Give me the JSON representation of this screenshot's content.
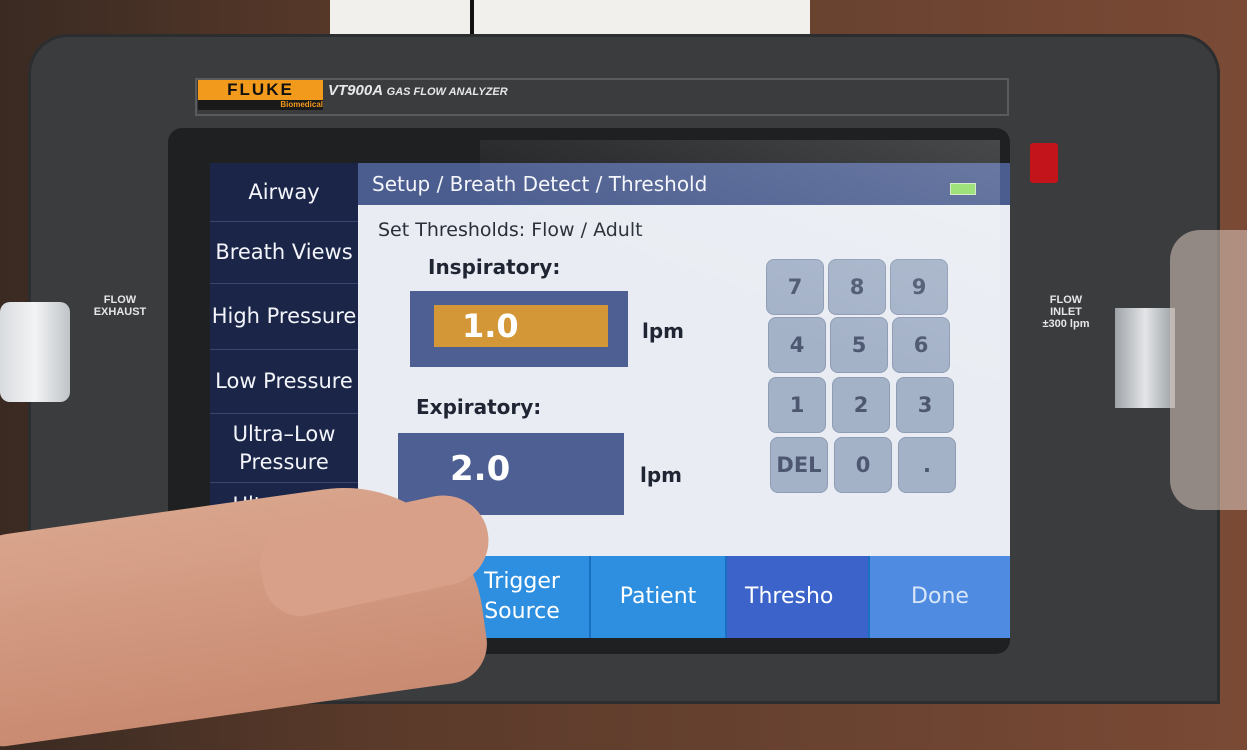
{
  "device": {
    "brand": "FLUKE",
    "brand_sub": "Biomedical",
    "model": "VT900A",
    "model_desc": "GAS FLOW ANALYZER",
    "left_port": "FLOW EXHAUST",
    "right_port_line1": "FLOW",
    "right_port_line2": "INLET",
    "right_port_line3": "±300 lpm"
  },
  "screen": {
    "breadcrumb": "Setup / Breath Detect / Threshold",
    "subtitle": "Set Thresholds:  Flow / Adult",
    "sidebar": {
      "items": [
        {
          "label": "Airway"
        },
        {
          "label": "Breath Views"
        },
        {
          "label": "High Pressure"
        },
        {
          "label": "Low Pressure"
        },
        {
          "label": "Ultra–Low Pressure"
        },
        {
          "label": "Ultra–Low"
        }
      ]
    },
    "inspiratory": {
      "label": "Inspiratory:",
      "value": "1.0",
      "unit": "lpm"
    },
    "expiratory": {
      "label": "Expiratory:",
      "value": "2.0",
      "unit": "lpm"
    },
    "keypad": {
      "keys": [
        "7",
        "8",
        "9",
        "4",
        "5",
        "6",
        "1",
        "2",
        "3",
        "DEL",
        "0",
        "."
      ]
    },
    "tabs": {
      "trigger_source": "Trigger Source",
      "patient": "Patient",
      "threshold": "Thresho",
      "done": "Done"
    }
  },
  "colors": {
    "sidebar_bg": "#1a2548",
    "header_bg": "#4b5d8f",
    "active_field": "#d49738",
    "tab_bar": "#2e8fe0",
    "brand_orange": "#f29a1c"
  }
}
